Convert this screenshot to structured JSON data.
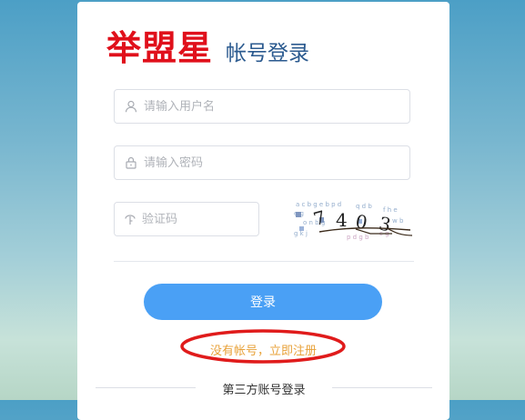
{
  "brand": {
    "logo": "举盟星",
    "subtitle": "帐号登录"
  },
  "form": {
    "username": {
      "placeholder": "请输入用户名",
      "icon": "user-icon"
    },
    "password": {
      "placeholder": "请输入密码",
      "icon": "lock-icon"
    },
    "captcha": {
      "placeholder": "验证码",
      "icon": "key-icon",
      "image_code": "7403"
    },
    "login_label": "登录",
    "register_link": "没有帐号，立即注册",
    "third_party_label": "第三方账号登录"
  },
  "colors": {
    "brand_red": "#e0101b",
    "primary": "#4aa0f5",
    "link": "#e8a23a",
    "ring": "#e01b1b"
  }
}
